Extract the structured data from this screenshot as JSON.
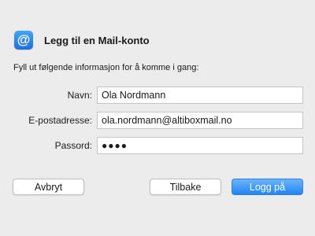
{
  "dialog": {
    "icon": "mail-app-icon",
    "icon_glyph": "@",
    "title": "Legg til en Mail-konto",
    "subtitle": "Fyll ut følgende informasjon for å komme i gang:"
  },
  "form": {
    "name_label": "Navn:",
    "name_value": "Ola Nordmann",
    "email_label": "E-postadresse:",
    "email_value": "ola.nordmann@altiboxmail.no",
    "password_label": "Passord:",
    "password_mask": "●●●●"
  },
  "buttons": {
    "cancel": "Avbryt",
    "back": "Tilbake",
    "login": "Logg på"
  }
}
